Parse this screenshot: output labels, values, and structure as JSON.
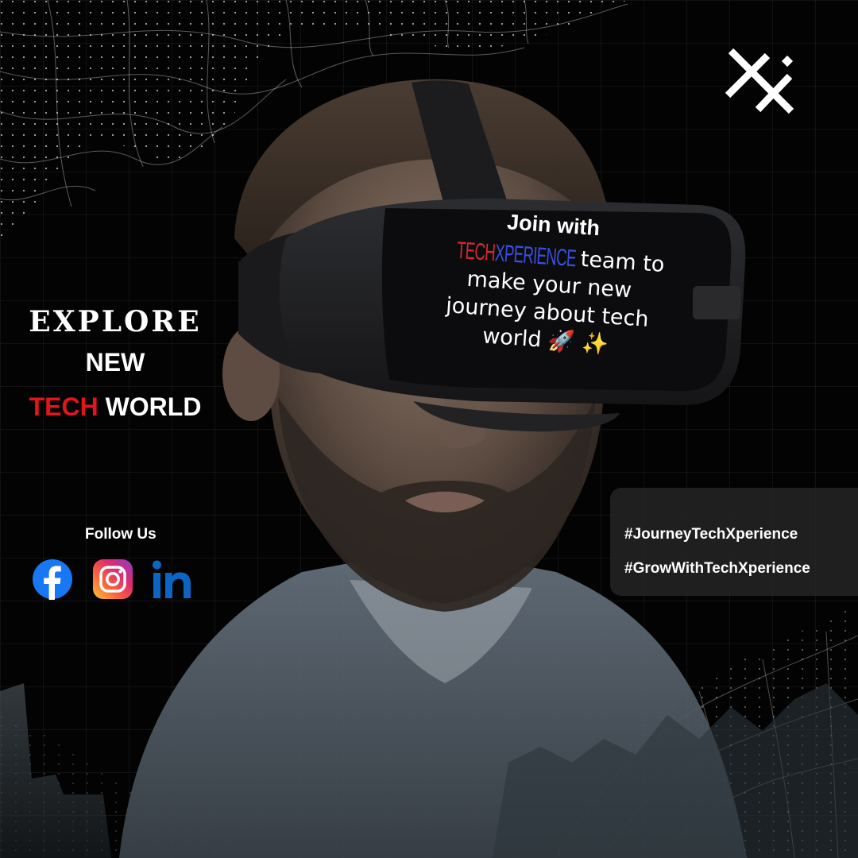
{
  "headline": {
    "line1": "EXPLORE",
    "line2": "NEW",
    "line3_highlight": "TECH",
    "line3_rest": "WORLD"
  },
  "follow": {
    "label": "Follow Us",
    "icons": [
      "facebook-icon",
      "instagram-icon",
      "linkedin-icon"
    ]
  },
  "visor": {
    "join": "Join with",
    "brand_part1": "TECH",
    "brand_part2": "XPERIENCE",
    "after_brand": "team to",
    "line2": "make your new",
    "line3": "journey about tech",
    "line4": "world 🚀 ✨"
  },
  "hashtags": [
    "#JourneyTechXperience",
    "#GrowWithTechXperience"
  ],
  "logo": "techxperience-x-logo",
  "colors": {
    "background": "#030303",
    "accent_red": "#e3151c",
    "brand_blue": "#3a4fe0",
    "facebook": "#1877f2",
    "linkedin": "#0a66c2"
  }
}
